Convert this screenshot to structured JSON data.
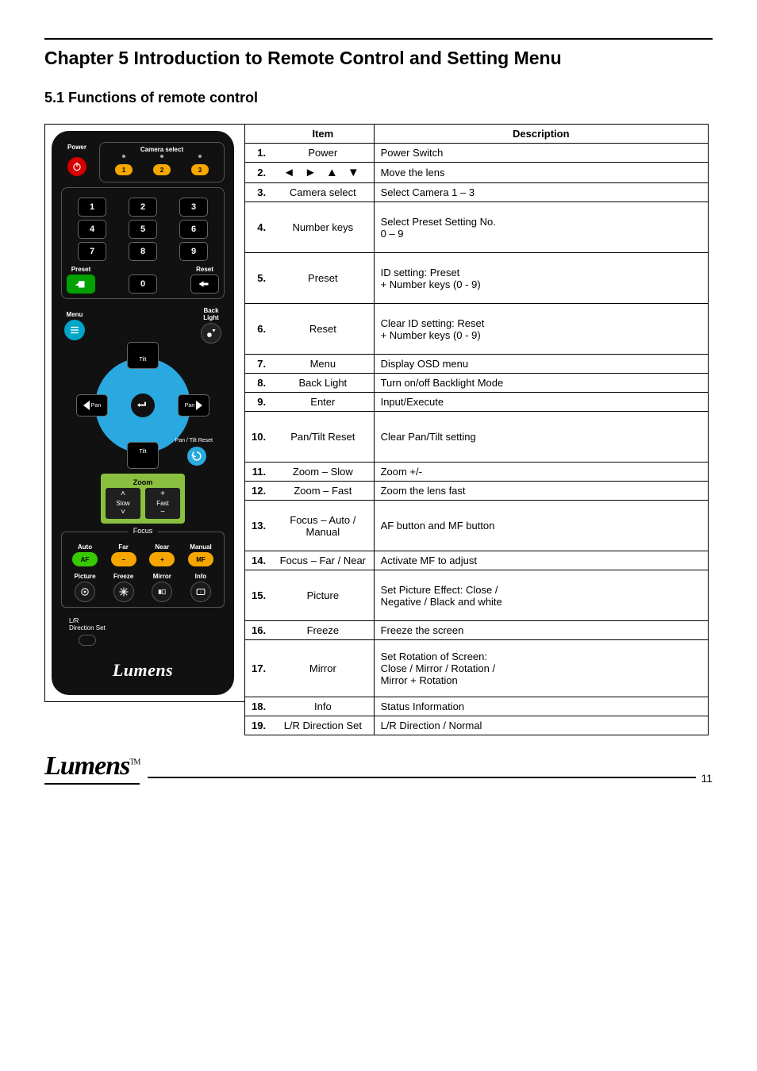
{
  "chapter_title": "Chapter 5 Introduction to Remote Control and Setting Menu",
  "section_title": "5.1 Functions of remote control",
  "icons": {
    "power": "power-icon",
    "preset_hand": "hand-icon",
    "reset_back": "back-arrow-icon",
    "menu": "menu-icon",
    "backlight": "backlight-icon",
    "enter": "enter-icon",
    "pt_reset": "reset-icon",
    "picture": "picture-icon",
    "freeze": "snowflake-icon",
    "mirror": "mirror-icon",
    "info": "info-icon"
  },
  "remote": {
    "power_label": "Power",
    "camera_select_label": "Camera select",
    "cam_buttons": [
      "1",
      "2",
      "3"
    ],
    "numpad": [
      "1",
      "2",
      "3",
      "4",
      "5",
      "6",
      "7",
      "8",
      "9",
      "0"
    ],
    "preset_label": "Preset",
    "reset_label": "Reset",
    "menu_label": "Menu",
    "backlight_label": "Back Light",
    "tilt_label": "Tilt",
    "pan_label": "Pan",
    "pt_reset_label": "Pan / Tilt\nReset",
    "zoom_label": "Zoom",
    "zoom_slow": "Slow",
    "zoom_fast": "Fast",
    "focus_label": "Focus",
    "focus_auto": "Auto",
    "focus_far": "Far",
    "focus_near": "Near",
    "focus_manual": "Manual",
    "af_label": "AF",
    "mf_label": "MF",
    "picture_label": "Picture",
    "freeze_label": "Freeze",
    "mirror_label": "Mirror",
    "info_label": "Info",
    "lr_label": "L/R\nDirection Set",
    "brand": "Lumens"
  },
  "table": {
    "headers": {
      "item": "Item",
      "description": "Description"
    },
    "rows": [
      {
        "n": 1,
        "item": "Power",
        "desc": "Power Switch"
      },
      {
        "n": 2,
        "item_arrows": true,
        "desc": "Move the lens"
      },
      {
        "n": 3,
        "item": "Camera select",
        "desc": "Select Camera 1 – 3"
      },
      {
        "n": 4,
        "item": "Number keys",
        "desc": "Select Preset Setting No.\n0 – 9"
      },
      {
        "n": 5,
        "item": "Preset",
        "desc": "ID setting: Preset\n+ Number keys (0 - 9)"
      },
      {
        "n": 6,
        "item": "Reset",
        "desc": "Clear ID setting: Reset\n+ Number keys (0 - 9)"
      },
      {
        "n": 7,
        "item": "Menu",
        "desc": "Display OSD menu"
      },
      {
        "n": 8,
        "item": "Back Light",
        "desc": "Turn on/off Backlight Mode"
      },
      {
        "n": 9,
        "item": "Enter",
        "desc": "Input/Execute"
      },
      {
        "n": 10,
        "item": "Pan/Tilt Reset",
        "desc": "Clear Pan/Tilt setting"
      },
      {
        "n": 11,
        "item": "Zoom – Slow",
        "desc": "Zoom +/-"
      },
      {
        "n": 12,
        "item": "Zoom – Fast",
        "desc": "Zoom the lens fast"
      },
      {
        "n": 13,
        "item": "Focus – Auto / Manual",
        "desc": "AF button and MF button"
      },
      {
        "n": 14,
        "item": "Focus – Far / Near",
        "desc": "Activate MF to adjust"
      },
      {
        "n": 15,
        "item": "Picture",
        "desc": "Set Picture Effect: Close /\nNegative / Black and white"
      },
      {
        "n": 16,
        "item": "Freeze",
        "desc": "Freeze the screen"
      },
      {
        "n": 17,
        "item": "Mirror",
        "desc": "Set Rotation of Screen:\nClose / Mirror / Rotation /\nMirror + Rotation"
      },
      {
        "n": 18,
        "item": "Info",
        "desc": "Status Information"
      },
      {
        "n": 19,
        "item": "L/R Direction Set",
        "desc": "L/R Direction / Normal"
      }
    ]
  },
  "footer": {
    "brand": "Lumens",
    "tm": "TM",
    "page": "11"
  }
}
